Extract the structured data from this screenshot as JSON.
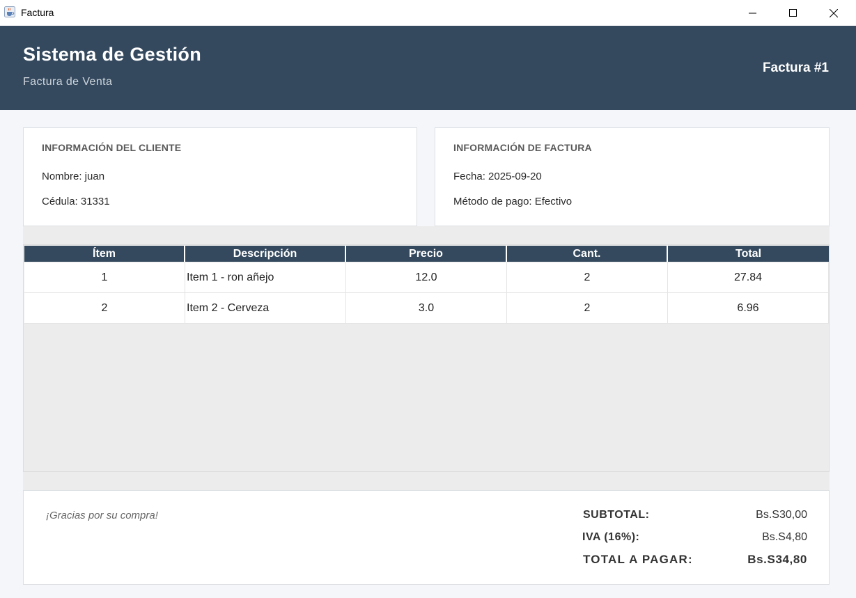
{
  "window": {
    "title": "Factura",
    "icon": "java-cup-icon",
    "controls": [
      "minimize-icon",
      "maximize-icon",
      "close-icon"
    ]
  },
  "header": {
    "brand": "Sistema de Gestión",
    "subtitle": "Factura de Venta",
    "invoice_number": "Factura #1",
    "bg_color": "#34495e"
  },
  "client": {
    "title": "INFORMACIÓN DEL CLIENTE",
    "name_line": "Nombre: juan",
    "id_line": "Cédula: 31331"
  },
  "invoice_info": {
    "title": "INFORMACIÓN DE FACTURA",
    "date_line": "Fecha: 2025-09-20",
    "payment_line": "Método de pago: Efectivo"
  },
  "table": {
    "headers": [
      "Ítem",
      "Descripción",
      "Precio",
      "Cant.",
      "Total"
    ],
    "rows": [
      [
        "1",
        "Item 1 - ron añejo",
        "12.0",
        "2",
        "27.84"
      ],
      [
        "2",
        "Item 2 - Cerveza",
        "3.0",
        "2",
        "6.96"
      ]
    ]
  },
  "footer": {
    "thanks": "¡Gracias por su compra!",
    "subtotal_label": "SUBTOTAL:",
    "subtotal_value": "Bs.S30,00",
    "iva_label": "IVA (16%):",
    "iva_value": "Bs.S4,80",
    "total_label": "TOTAL A PAGAR:",
    "total_value": "Bs.S34,80"
  }
}
